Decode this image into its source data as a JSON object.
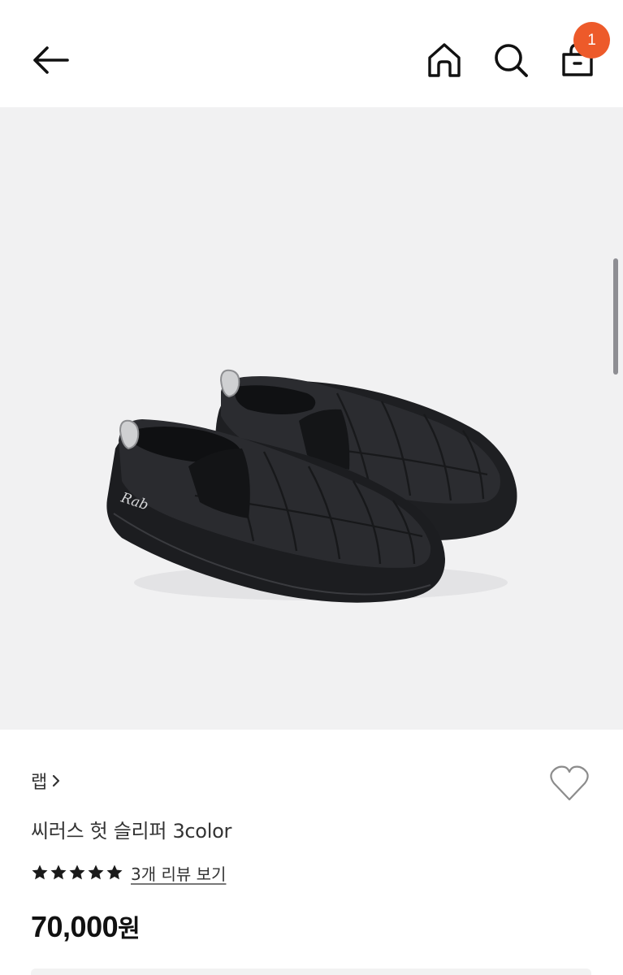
{
  "header": {
    "back_icon": "arrow-left-icon",
    "home_icon": "home-icon",
    "search_icon": "search-icon",
    "cart_icon": "shopping-bag-icon",
    "cart_count": "1",
    "badge_color": "#ed5a2a"
  },
  "product_image": {
    "logo_text": "Rab",
    "background_color": "#f1f1f2"
  },
  "product": {
    "brand": "랩",
    "title": "씨러스 헛 슬리퍼 3color",
    "rating_stars": 5,
    "review_link": "3개 리뷰 보기",
    "price": "70,000",
    "currency": "원",
    "wishlist_icon": "heart-outline-icon"
  }
}
